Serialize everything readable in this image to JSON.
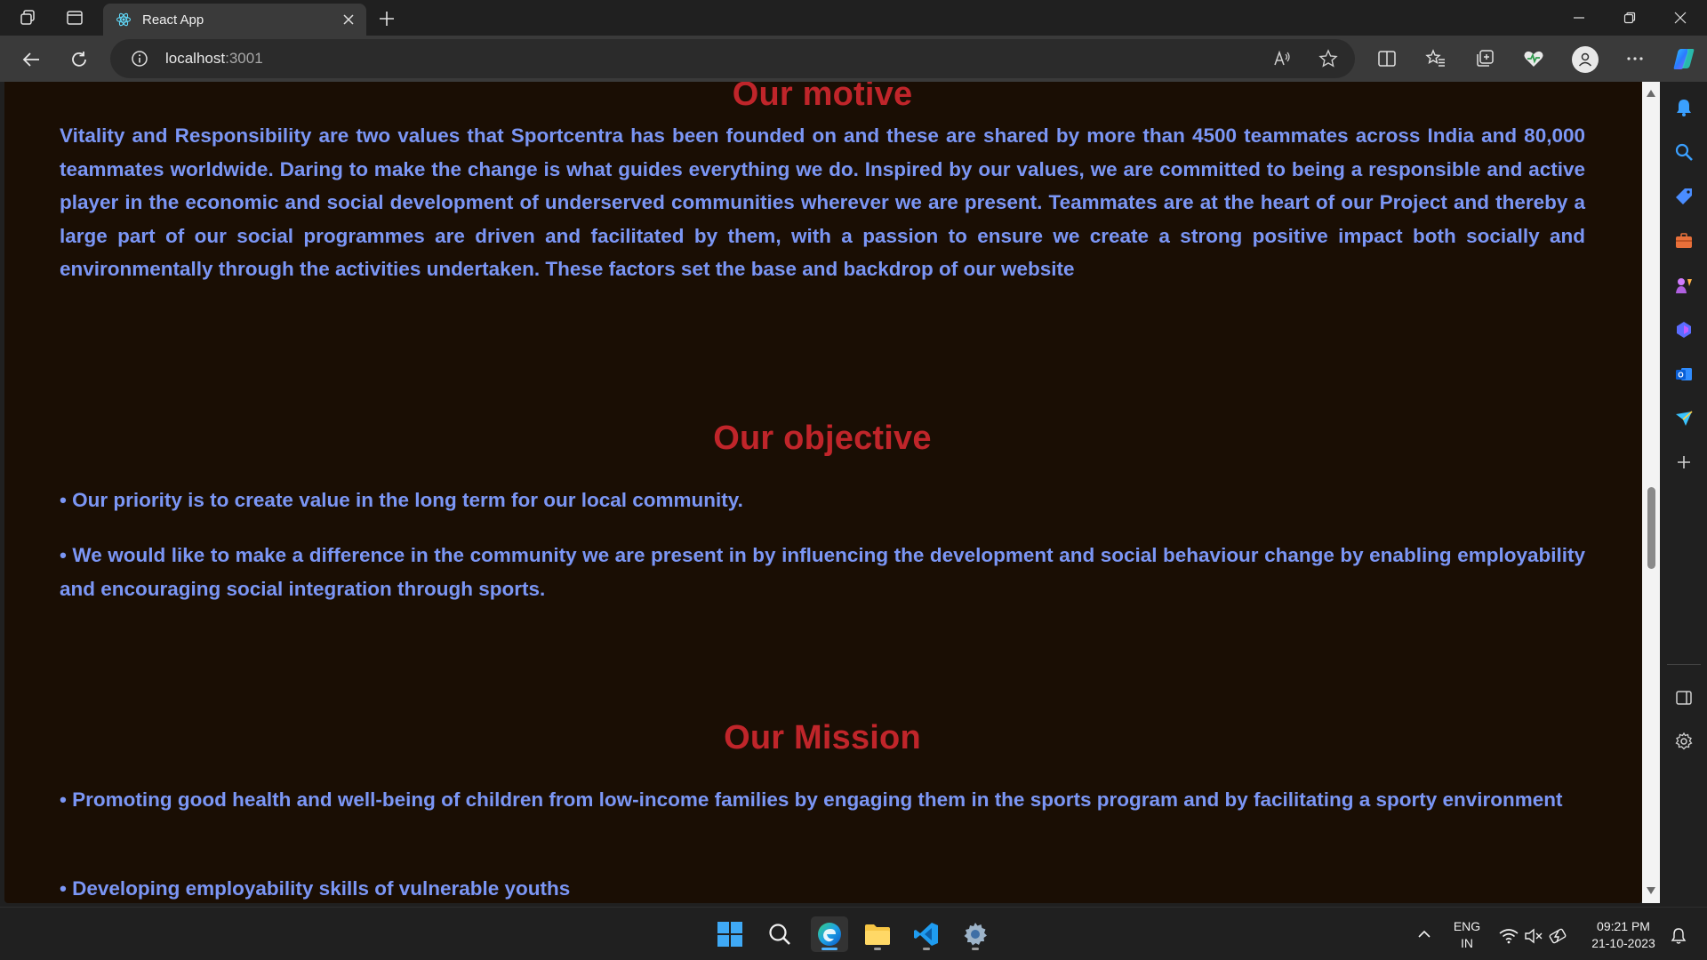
{
  "browser": {
    "tab_title": "React App",
    "url_host": "localhost",
    "url_port": ":3001"
  },
  "page": {
    "sections": [
      {
        "heading": "Our motive",
        "paragraphs": [
          "Vitality and Responsibility are two values that Sportcentra has been founded on and these are shared by more than 4500 teammates across India and 80,000 teammates worldwide. Daring to make the change is what guides everything we do. Inspired by our values, we are committed to being a responsible and active player in the economic and social development of underserved communities wherever we are present. Teammates are at the heart of our Project and thereby a large part of our social programmes are driven and facilitated by them, with a passion to ensure we create a strong positive impact both socially and environmentally through the activities undertaken. These factors set the base and backdrop of our website"
        ]
      },
      {
        "heading": "Our objective",
        "paragraphs": [
          "• Our priority is to create value in the long term for our local community.",
          "• We would like to make a difference in the community we are present in by influencing the development and social behaviour change by enabling employability and encouraging social integration through sports."
        ]
      },
      {
        "heading": "Our Mission",
        "paragraphs": [
          "• Promoting good health and well-being of children from low-income families by engaging them in the sports program and by facilitating a sporty environment",
          "• Developing employability skills of vulnerable youths"
        ]
      }
    ]
  },
  "taskbar": {
    "lang_line1": "ENG",
    "lang_line2": "IN",
    "time": "09:21 PM",
    "date": "21-10-2023"
  },
  "colors": {
    "page_bg": "#1a0e04",
    "heading": "#c0252a",
    "body_text": "#7b96f5"
  }
}
